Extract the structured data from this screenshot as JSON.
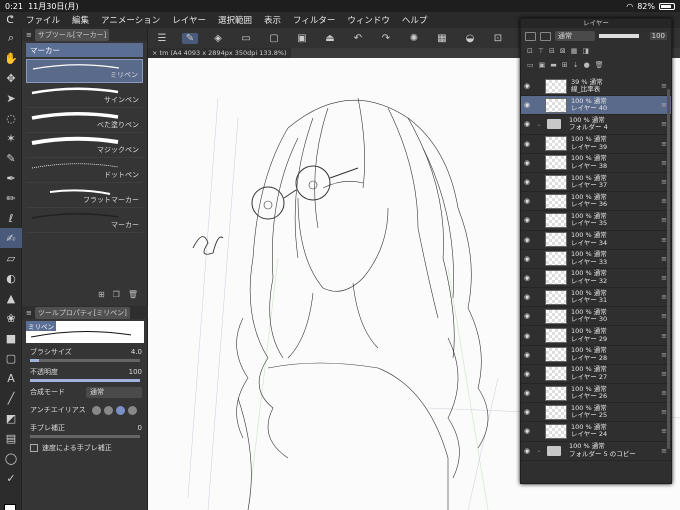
{
  "status": {
    "time": "0:21",
    "date": "11月30日(月)",
    "battery": "82%"
  },
  "menu": [
    "ファイル",
    "編集",
    "アニメーション",
    "レイヤー",
    "選択範囲",
    "表示",
    "フィルター",
    "ウィンドウ",
    "ヘルプ"
  ],
  "subtool": {
    "tab": "サブツール[マーカー]",
    "group": "マーカー",
    "brushes": [
      "ミリペン",
      "サインペン",
      "べた塗りペン",
      "マジックペン",
      "ドットペン",
      "フラットマーカー",
      "マーカー"
    ]
  },
  "toolprop": {
    "tab": "ツールプロパティ[ミリペン]",
    "preview_label": "ミリペン",
    "brush_size_label": "ブラシサイズ",
    "brush_size": "4.0",
    "opacity_label": "不透明度",
    "opacity": "100",
    "blend_label": "合成モード",
    "blend": "通常",
    "aa_label": "アンチエイリアス",
    "stab_label": "手ブレ補正",
    "stab": "0",
    "speed_stab_label": "速度による手ブレ補正"
  },
  "document": {
    "tab": "tm (A4 4093 x 2894px 350dpi 133.8%)"
  },
  "layers": {
    "title": "レイヤー",
    "blend": "通常",
    "opacity": "100",
    "rows": [
      {
        "top": "39 %  通常",
        "bottom": "線_比率表",
        "type": "layer",
        "selected": false
      },
      {
        "top": "100 %  通常",
        "bottom": "レイヤー 40",
        "type": "layer",
        "selected": true
      },
      {
        "top": "100 %  通常",
        "bottom": "フォルダー 4",
        "type": "folder",
        "selected": false
      },
      {
        "top": "100 %  通常",
        "bottom": "レイヤー 39",
        "type": "layer",
        "selected": false
      },
      {
        "top": "100 %  通常",
        "bottom": "レイヤー 38",
        "type": "layer",
        "selected": false
      },
      {
        "top": "100 %  通常",
        "bottom": "レイヤー 37",
        "type": "layer",
        "selected": false
      },
      {
        "top": "100 %  通常",
        "bottom": "レイヤー 36",
        "type": "layer",
        "selected": false
      },
      {
        "top": "100 %  通常",
        "bottom": "レイヤー 35",
        "type": "layer",
        "selected": false
      },
      {
        "top": "100 %  通常",
        "bottom": "レイヤー 34",
        "type": "layer",
        "selected": false
      },
      {
        "top": "100 %  通常",
        "bottom": "レイヤー 33",
        "type": "layer",
        "selected": false
      },
      {
        "top": "100 %  通常",
        "bottom": "レイヤー 32",
        "type": "layer",
        "selected": false
      },
      {
        "top": "100 %  通常",
        "bottom": "レイヤー 31",
        "type": "layer",
        "selected": false
      },
      {
        "top": "100 %  通常",
        "bottom": "レイヤー 30",
        "type": "layer",
        "selected": false
      },
      {
        "top": "100 %  通常",
        "bottom": "レイヤー 29",
        "type": "layer",
        "selected": false
      },
      {
        "top": "100 %  通常",
        "bottom": "レイヤー 28",
        "type": "layer",
        "selected": false
      },
      {
        "top": "100 %  通常",
        "bottom": "レイヤー 27",
        "type": "layer",
        "selected": false
      },
      {
        "top": "100 %  通常",
        "bottom": "レイヤー 26",
        "type": "layer",
        "selected": false
      },
      {
        "top": "100 %  通常",
        "bottom": "レイヤー 25",
        "type": "layer",
        "selected": false
      },
      {
        "top": "100 %  通常",
        "bottom": "レイヤー 24",
        "type": "layer",
        "selected": false
      },
      {
        "top": "100 %  通常",
        "bottom": "フォルダー 5 のコピー",
        "type": "folder",
        "selected": false
      }
    ]
  }
}
